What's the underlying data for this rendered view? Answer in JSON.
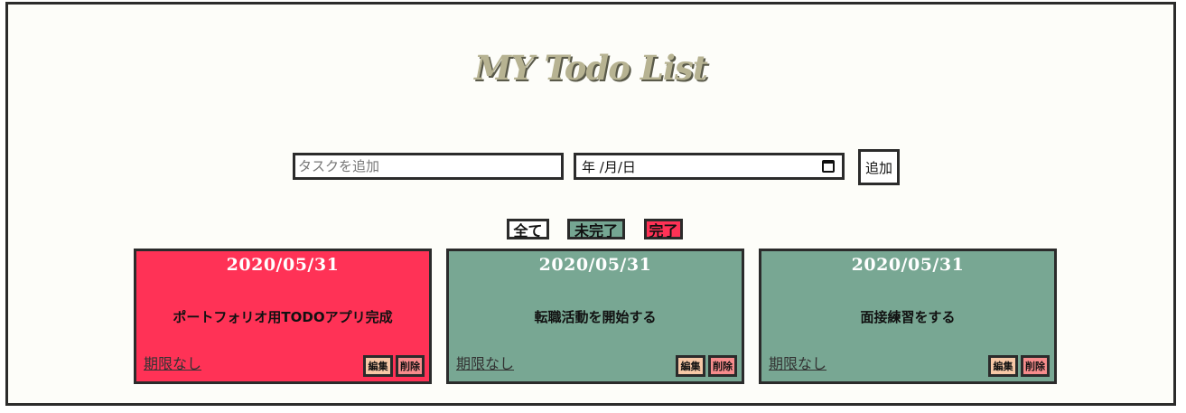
{
  "header": {
    "title": "MY Todo List"
  },
  "form": {
    "task_placeholder": "タスクを追加",
    "date_placeholder": "年 /月/日",
    "add_label": "追加"
  },
  "filters": {
    "all": "全て",
    "undone": "未完了",
    "done": "完了"
  },
  "cards": [
    {
      "date": "2020/05/31",
      "text": "ポートフォリオ用TODOアプリ完成",
      "deadline": "期限なし",
      "edit": "編集",
      "delete": "削除",
      "status": "done"
    },
    {
      "date": "2020/05/31",
      "text": "転職活動を開始する",
      "deadline": "期限なし",
      "edit": "編集",
      "delete": "削除",
      "status": "undone"
    },
    {
      "date": "2020/05/31",
      "text": "面接練習をする",
      "deadline": "期限なし",
      "edit": "編集",
      "delete": "削除",
      "status": "undone"
    }
  ],
  "colors": {
    "done": "#ff3256",
    "undone": "#78a793",
    "title": "#b7b392"
  }
}
